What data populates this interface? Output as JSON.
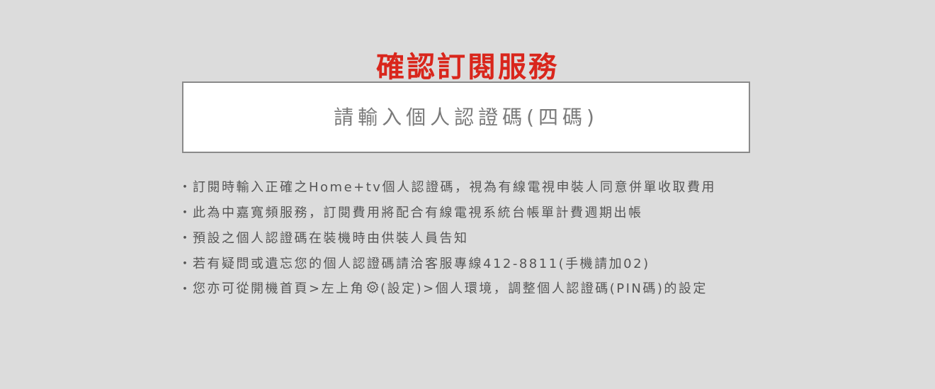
{
  "title": "確認訂閱服務",
  "pin_input": {
    "placeholder": "請輸入個人認證碼(四碼)",
    "value": ""
  },
  "bullet": "・",
  "notes": [
    "訂閱時輸入正確之Home+tv個人認證碼，視為有線電視申裝人同意併單收取費用",
    "此為中嘉寬頻服務，訂閱費用將配合有線電視系統台帳單計費週期出帳",
    "預設之個人認證碼在裝機時由供裝人員告知",
    "若有疑問或遺忘您的個人認證碼請洽客服專線412-8811(手機請加02)"
  ],
  "note5": {
    "before_icon": "您亦可從開機首頁>左上角",
    "icon": "gear-icon",
    "after_icon": "(設定)>個人環境，調整個人認證碼(PIN碼)的設定"
  },
  "colors": {
    "background": "#dcdcdc",
    "title": "#d9261c",
    "text": "#555555",
    "input_border": "#8a8a8a"
  }
}
